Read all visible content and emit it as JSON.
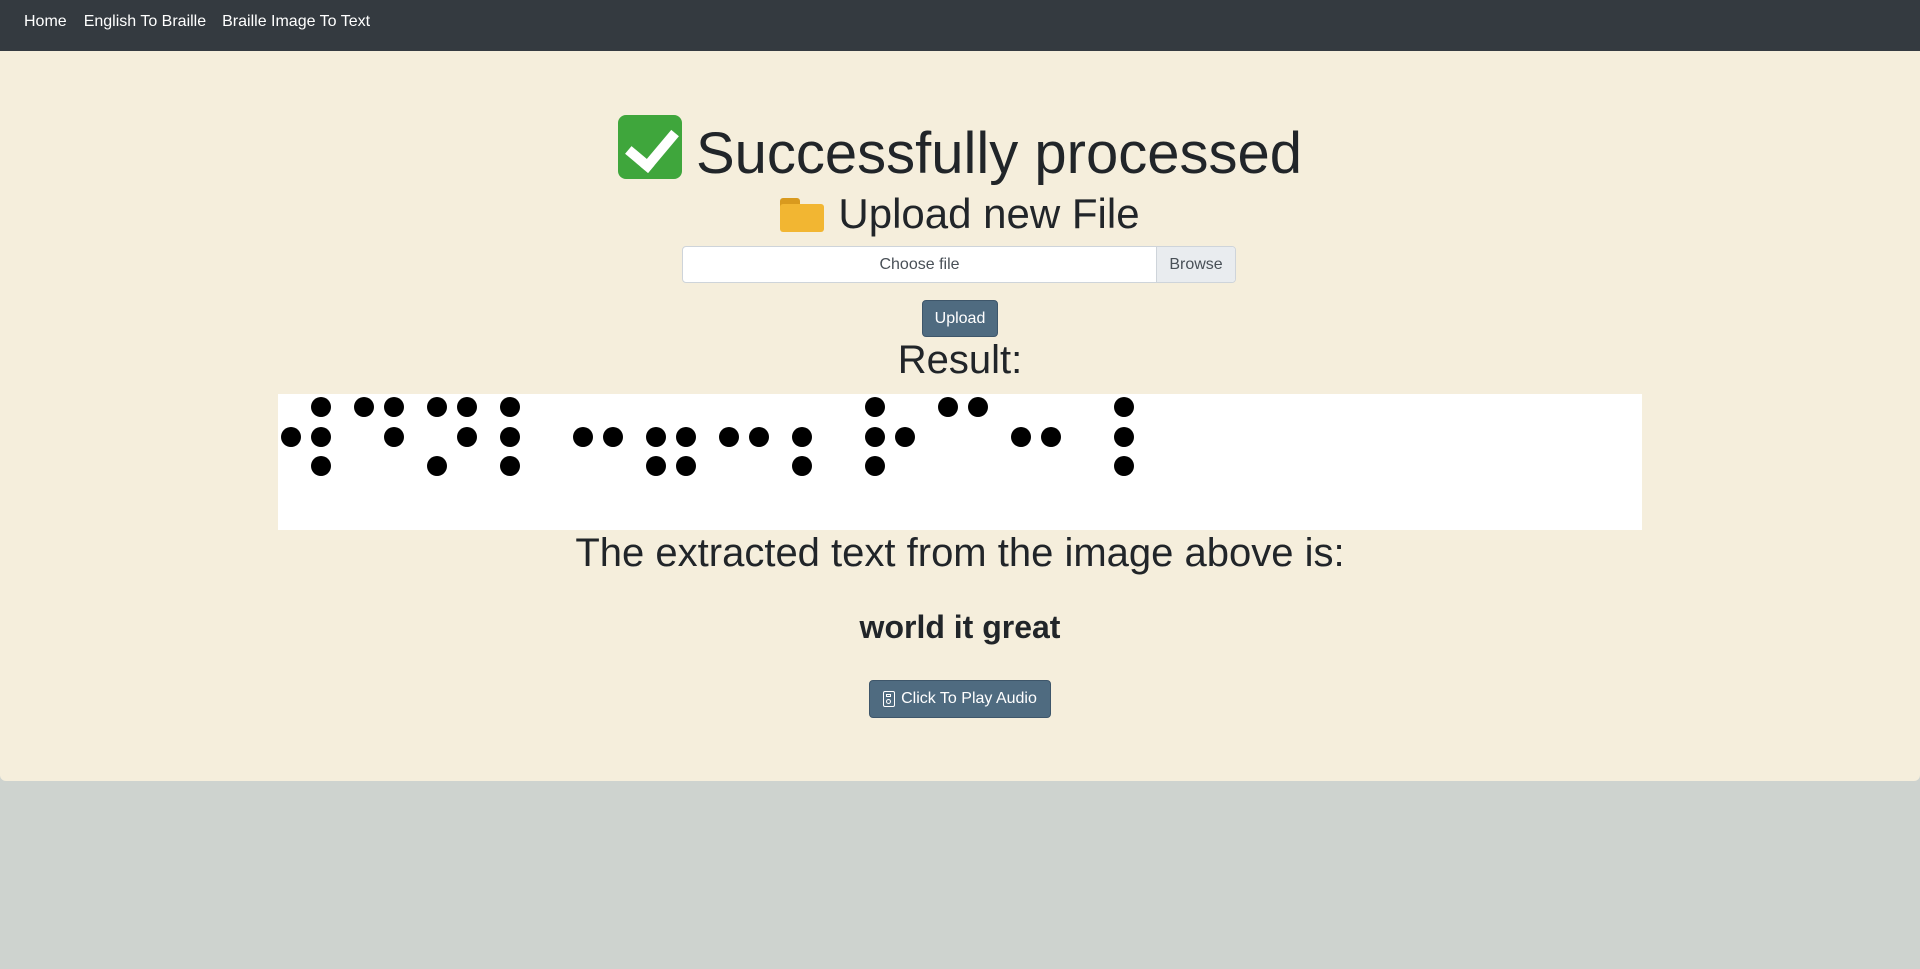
{
  "nav": {
    "items": [
      {
        "label": "Home"
      },
      {
        "label": "English To Braille"
      },
      {
        "label": "Braille Image To Text"
      }
    ]
  },
  "main": {
    "status_title": "Successfully processed",
    "status_icon": "check-mark-emoji",
    "upload_heading": "Upload new File",
    "upload_icon": "folder-emoji",
    "file_input": {
      "label": "Choose file",
      "browse_label": "Browse"
    },
    "upload_button": "Upload",
    "result_heading": "Result:",
    "braille_cells": [
      [
        0,
        1,
        0,
        1,
        1,
        1
      ],
      [
        1,
        0,
        0,
        1,
        1,
        0
      ],
      [
        1,
        0,
        1,
        1,
        1,
        0
      ],
      [
        1,
        1,
        1,
        0,
        0,
        0
      ],
      [
        0,
        1,
        0,
        0,
        1,
        0
      ],
      [
        0,
        1,
        1,
        0,
        1,
        1
      ],
      [
        0,
        1,
        0,
        0,
        1,
        0
      ],
      [
        0,
        1,
        1,
        0,
        0,
        0
      ],
      [
        1,
        1,
        1,
        0,
        1,
        0
      ],
      [
        1,
        0,
        0,
        1,
        0,
        0
      ],
      [
        0,
        1,
        0,
        0,
        1,
        0
      ],
      [
        0,
        0,
        0,
        1,
        1,
        1
      ]
    ],
    "extracted_heading": "The extracted text from the image above is:",
    "extracted_text": "world it great",
    "audio_button": "Click To Play Audio",
    "audio_icon": "speaker-icon"
  },
  "colors": {
    "navbar": "#343a40",
    "card": "#f5eedc",
    "page": "#ced3cf",
    "button": "#4f6b80"
  }
}
